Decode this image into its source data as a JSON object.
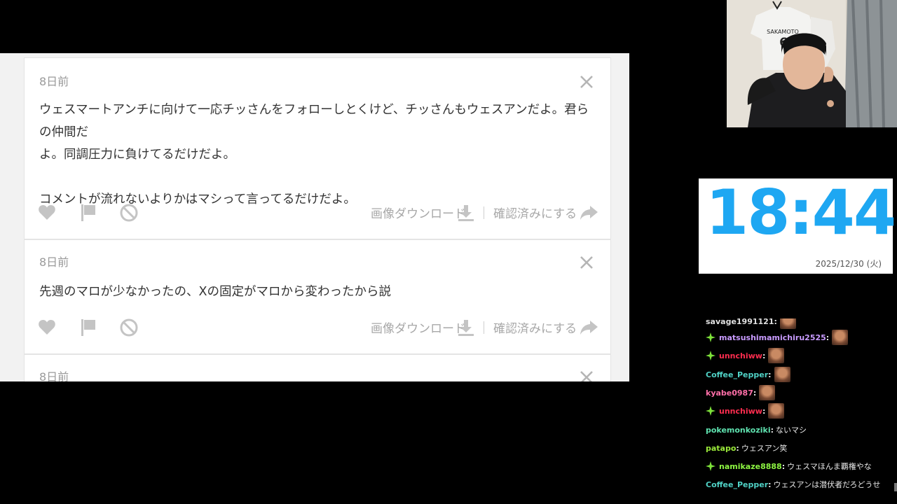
{
  "cards": [
    {
      "time": "8日前",
      "message": "ウェスマートアンチに向けて一応チッさんをフォローしとくけど、チッさんもウェスアンだよ。君らの仲間だ\nよ。同調圧力に負けてるだけだよ。\n\nコメントが流れないよりかはマシって言ってるだけだよ。",
      "download_label": "画像ダウンロード",
      "confirm_label": "確認済みにする"
    },
    {
      "time": "8日前",
      "message": "先週のマロが少なかったの、Xの固定がマロから変わったから説",
      "download_label": "画像ダウンロード",
      "confirm_label": "確認済みにする"
    },
    {
      "time": "8日前",
      "message": "",
      "download_label": "",
      "confirm_label": ""
    }
  ],
  "clock": {
    "time": "18:44",
    "date": "2025/12/30 (火)",
    "color": "#1ea7f2"
  },
  "webcam": {
    "jersey_name": "SAKAMOTO",
    "jersey_number": "6"
  },
  "chat": {
    "messages": [
      {
        "user": "savage1991121",
        "color": "#e0e0e0",
        "badge": false,
        "text": "",
        "emote": true
      },
      {
        "user": "matsushimamichiru2525",
        "color": "#c99bff",
        "badge": true,
        "text": "",
        "emote": true
      },
      {
        "user": "unnchiww",
        "color": "#ff2d4f",
        "badge": true,
        "text": "",
        "emote": true
      },
      {
        "user": "Coffee_Pepper",
        "color": "#4fd1c5",
        "badge": false,
        "text": "",
        "emote": true
      },
      {
        "user": "kyabe0987",
        "color": "#ff6fa8",
        "badge": false,
        "text": "",
        "emote": true
      },
      {
        "user": "unnchiww",
        "color": "#ff2d4f",
        "badge": true,
        "text": "",
        "emote": true
      },
      {
        "user": "pokemonkoziki",
        "color": "#5fe3b0",
        "badge": false,
        "text": "ないマシ",
        "emote": false
      },
      {
        "user": "patapo",
        "color": "#9bea3a",
        "badge": false,
        "text": "ウェスアン笑",
        "emote": false
      },
      {
        "user": "namikaze8888",
        "color": "#8df542",
        "badge": true,
        "text": "ウェスマほんま覇権やな",
        "emote": false
      },
      {
        "user": "Coffee_Pepper",
        "color": "#4fd1c5",
        "badge": false,
        "text": "ウェスアンは潜伏者だろどうせ",
        "emote": false
      }
    ]
  },
  "icons": {
    "like": "heart-icon",
    "report": "flag-icon",
    "block": "block-icon",
    "download": "download-icon",
    "confirm": "share-arrow-icon",
    "close": "close-icon",
    "badge": "sparkle-badge-icon"
  }
}
